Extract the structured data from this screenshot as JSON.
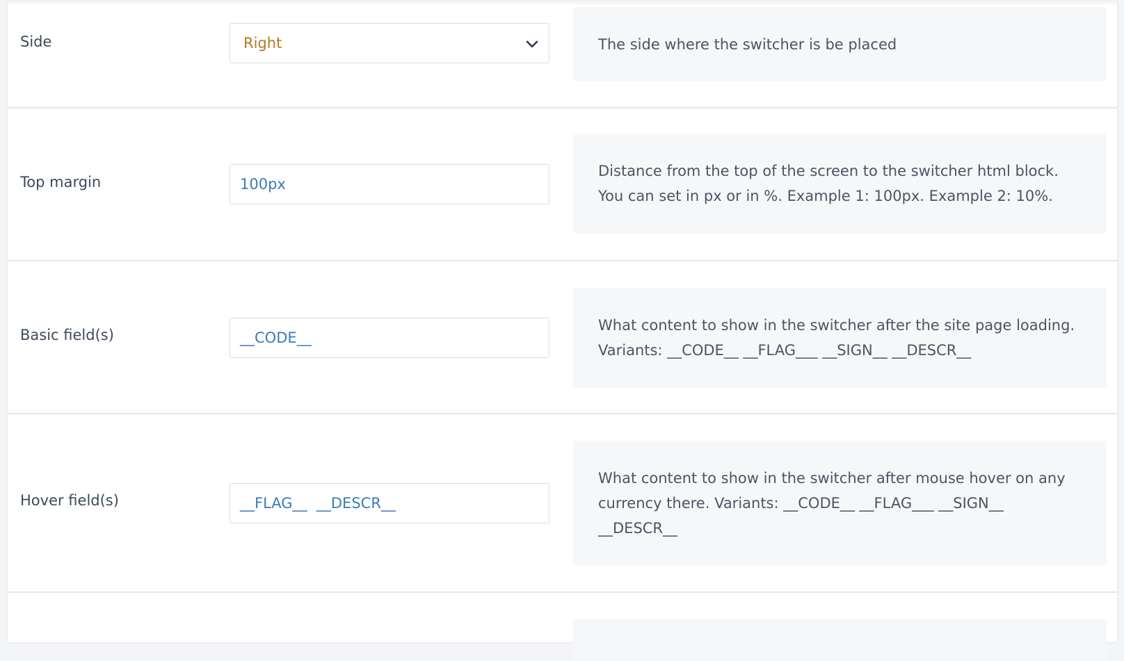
{
  "colors": {
    "select_value": "#b07a1f",
    "input_value": "#3c7ab8",
    "label": "#3d4a5c",
    "description_bg": "#f6f7f9"
  },
  "rows": [
    {
      "label": "Side",
      "control_type": "select",
      "value": "Right",
      "icon": "chevron-down-icon",
      "description": "The side where the switcher is be placed"
    },
    {
      "label": "Top margin",
      "control_type": "input",
      "value": "100px",
      "description": "Distance from the top of the screen to the switcher html block. You can set in px or in %. Example 1: 100px. Example 2: 10%."
    },
    {
      "label": "Basic field(s)",
      "control_type": "input",
      "value": "__CODE__",
      "description": "What content to show in the switcher after the site page loading. Variants: __CODE__ __FLAG___ __SIGN__ __DESCR__"
    },
    {
      "label": "Hover field(s)",
      "control_type": "input",
      "value": "__FLAG__  __DESCR__",
      "description": "What content to show in the switcher after mouse hover on any currency there. Variants: __CODE__ __FLAG___ __SIGN__ __DESCR__"
    }
  ]
}
